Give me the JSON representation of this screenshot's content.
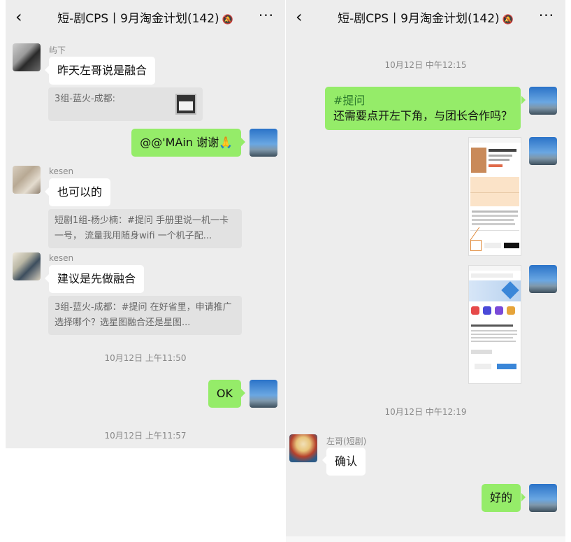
{
  "chat_title": "短-剧CPS丨9月淘金计划(142)",
  "icons": {
    "back": "chevron-left-icon",
    "mute": "bell-off-icon",
    "more": "more-dots-icon"
  },
  "glyphs": {
    "back": "‹",
    "mute": "🔕",
    "more": "···"
  },
  "colors": {
    "panel_bg": "#ededed",
    "bubble_self": "#95ec69",
    "bubble_other": "#ffffff",
    "quote_bg": "#e2e2e2"
  },
  "left": {
    "messages": [
      {
        "sender": "屿下",
        "text": "昨天左哥说是融合",
        "quote": "3组-蓝火-成都:"
      },
      {
        "self_text": "@@'MAin 谢谢🙏"
      },
      {
        "sender": "kesen",
        "text": "也可以的",
        "quote": "短剧1组-杨少楠：#提问 手册里说一机一卡一号， 流量我用随身wifi 一个机子配..."
      },
      {
        "sender": "kesen",
        "text": "建议是先做融合",
        "quote": "3组-蓝火-成都：#提问 在好省里，申请推广选择哪个？选星图融合还是星图..."
      }
    ],
    "timestamp_1": "10月12日 上午11:50",
    "self_ok": "OK",
    "timestamp_2": "10月12日 上午11:57"
  },
  "right": {
    "timestamp_1": "10月12日 中午12:15",
    "self_question_tag": "#提问",
    "self_question": "还需要点开左下角，与团长合作吗？",
    "timestamp_2": "10月12日 中午12:19",
    "sender": "左哥(短剧)",
    "reply": "确认",
    "self_reply": "好的"
  }
}
